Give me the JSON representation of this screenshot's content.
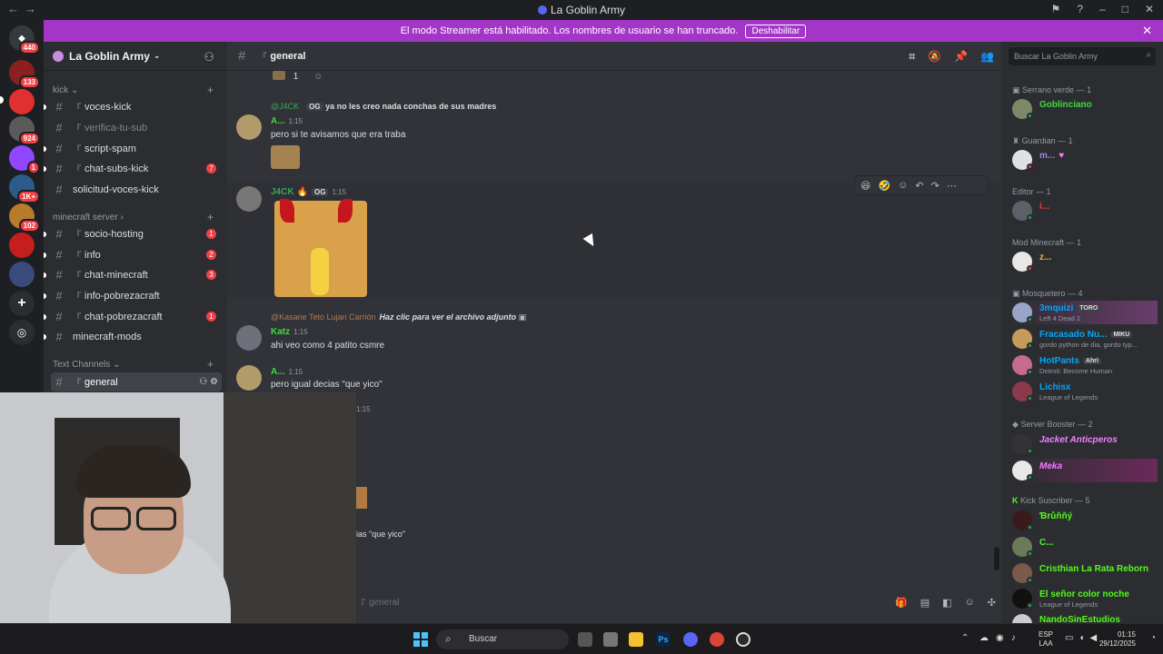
{
  "window": {
    "title": "La Goblin Army"
  },
  "banner": {
    "text": "El modo Streamer está habilitado. Los nombres de usuario se han truncado.",
    "button": "Deshabilitar"
  },
  "servers": [
    {
      "badge": "440"
    },
    {
      "badge": "133"
    },
    {
      "badge": ""
    },
    {
      "badge": "924"
    },
    {
      "badge": "1"
    },
    {
      "badge": "1K+"
    },
    {
      "badge": "102"
    },
    {
      "badge": ""
    },
    {
      "badge": ""
    }
  ],
  "sidebar": {
    "guild_name": "La Goblin Army",
    "categories": [
      {
        "label": "kick"
      },
      {
        "label": "minecraft server"
      },
      {
        "label": "Text Channels"
      }
    ],
    "channels": [
      {
        "name": "voces-kick",
        "prefix": "『",
        "count": ""
      },
      {
        "name": "verifica-tu-sub",
        "prefix": "『",
        "count": ""
      },
      {
        "name": "script-spam",
        "prefix": "『",
        "count": ""
      },
      {
        "name": "chat-subs-kick",
        "prefix": "『",
        "count": "7"
      },
      {
        "name": "solicitud-voces-kick",
        "prefix": "",
        "count": ""
      },
      {
        "name": "socio-hosting",
        "prefix": "『",
        "count": "1"
      },
      {
        "name": "info",
        "prefix": "『",
        "count": "2"
      },
      {
        "name": "chat-minecraft",
        "prefix": "『",
        "count": "3"
      },
      {
        "name": "info-pobrezacraft",
        "prefix": "『",
        "count": ""
      },
      {
        "name": "chat-pobrezacraft",
        "prefix": "『",
        "count": "1"
      },
      {
        "name": "minecraft-mods",
        "prefix": "",
        "count": ""
      },
      {
        "name": "general",
        "prefix": "『",
        "count": ""
      }
    ]
  },
  "header": {
    "channel": "general",
    "search_placeholder": "Buscar La Goblin Army"
  },
  "messages": {
    "reaction_count": "1",
    "m1": {
      "reply_user": "@J4CK",
      "reply_tag": "OG",
      "reply_text": "ya no les creo nada conchas de sus madres",
      "user": "A...",
      "time": "1:15",
      "text": "pero si te avisamos que era traba"
    },
    "m2": {
      "user": "J4CK",
      "tag": "OG",
      "time": "1:15"
    },
    "m3": {
      "reply_user": "@Kasane Teto Lujan Carrión",
      "reply_text": "Haz clic para ver el archivo adjunto",
      "user": "Katz",
      "time": "1:15",
      "text": "ahi veo como 4 patito csmre"
    },
    "m4": {
      "user": "A...",
      "time": "1:15",
      "text": "pero igual decias \"que yico\""
    },
    "m5": {
      "time": "1:15",
      "text": "ias \"que yico\""
    },
    "composer_placeholder": "general"
  },
  "members": {
    "groups": [
      {
        "label": "Serrano verde — 1"
      },
      {
        "label": "Guardian — 1"
      },
      {
        "label": "Editor — 1"
      },
      {
        "label": "Mod Minecraft — 1"
      },
      {
        "label": "Mosquetero — 4"
      },
      {
        "label": "Server Booster — 2"
      },
      {
        "label": "Kick Suscriber — 5"
      }
    ],
    "list": [
      {
        "name": "Goblinciano",
        "status": "",
        "badge": "",
        "color": "#3ddc3d"
      },
      {
        "name": "m...",
        "status": "",
        "badge": "",
        "color": "#9b84ee"
      },
      {
        "name": "i...",
        "status": "",
        "badge": "",
        "color": "#f23f43"
      },
      {
        "name": "z...",
        "status": "",
        "badge": "",
        "color": "#f0b232"
      },
      {
        "name": "3mquizi",
        "status": "Left 4 Dead 2",
        "badge": "TORO",
        "color": "#00a8fc"
      },
      {
        "name": "Fracasado Nu...",
        "status": "gordo python de dia, gordo typ...",
        "badge": "MIKU",
        "color": "#00a8fc"
      },
      {
        "name": "HotPants",
        "status": "Detroit: Become Human",
        "badge": "Ahri",
        "color": "#00a8fc"
      },
      {
        "name": "Lichisx",
        "status": "League of Legends",
        "badge": "",
        "color": "#00a8fc"
      },
      {
        "name": "Jacket Anticperos",
        "status": "",
        "badge": "",
        "color": "#f47fff"
      },
      {
        "name": "Meka",
        "status": "",
        "badge": "",
        "color": "#f47fff"
      },
      {
        "name": "Ɓrůňňý",
        "status": "",
        "badge": "",
        "color": "#53fc18"
      },
      {
        "name": "C...",
        "status": "",
        "badge": "",
        "color": "#53fc18"
      },
      {
        "name": "Cristhian La Rata Reborn",
        "status": "",
        "badge": "",
        "color": "#53fc18"
      },
      {
        "name": "El señor color noche",
        "status": "League of Legends",
        "badge": "",
        "color": "#53fc18"
      },
      {
        "name": "NandoSinEstudios",
        "status": "",
        "badge": "",
        "color": "#53fc18"
      }
    ]
  },
  "taskbar": {
    "search": "Buscar",
    "lang1": "ESP",
    "lang2": "LAA",
    "time": "01:15",
    "date": "29/12/2025"
  }
}
